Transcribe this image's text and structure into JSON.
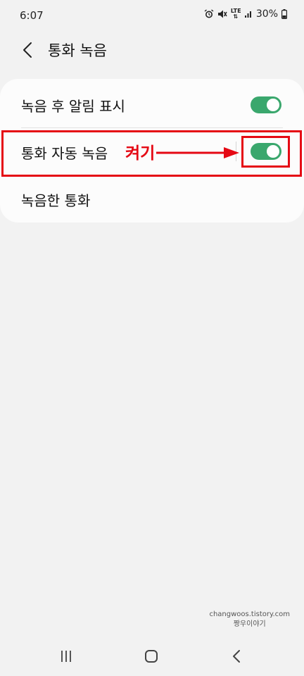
{
  "status_bar": {
    "time": "6:07",
    "battery": "30%",
    "network": "LTE",
    "icons": [
      "alarm-icon",
      "mute-icon",
      "lte-icon",
      "signal-icon",
      "battery-icon"
    ]
  },
  "header": {
    "title": "통화 녹음",
    "back_icon": "back-chevron-icon"
  },
  "settings": [
    {
      "label": "녹음 후 알림 표시",
      "toggle": true
    },
    {
      "label": "통화 자동 녹음",
      "toggle": true
    },
    {
      "label": "녹음한 통화"
    }
  ],
  "annotation": {
    "text": "켜기",
    "color": "#e50914"
  },
  "watermark": {
    "line1": "changwoos.tistory.com",
    "line2": "짱우이야기"
  },
  "navbar": {
    "icons": [
      "recents-icon",
      "home-icon",
      "back-icon"
    ]
  },
  "colors": {
    "accent": "#3aa76d",
    "annotation": "#e50914",
    "background": "#f2f2f2",
    "card": "#fcfcfc"
  }
}
